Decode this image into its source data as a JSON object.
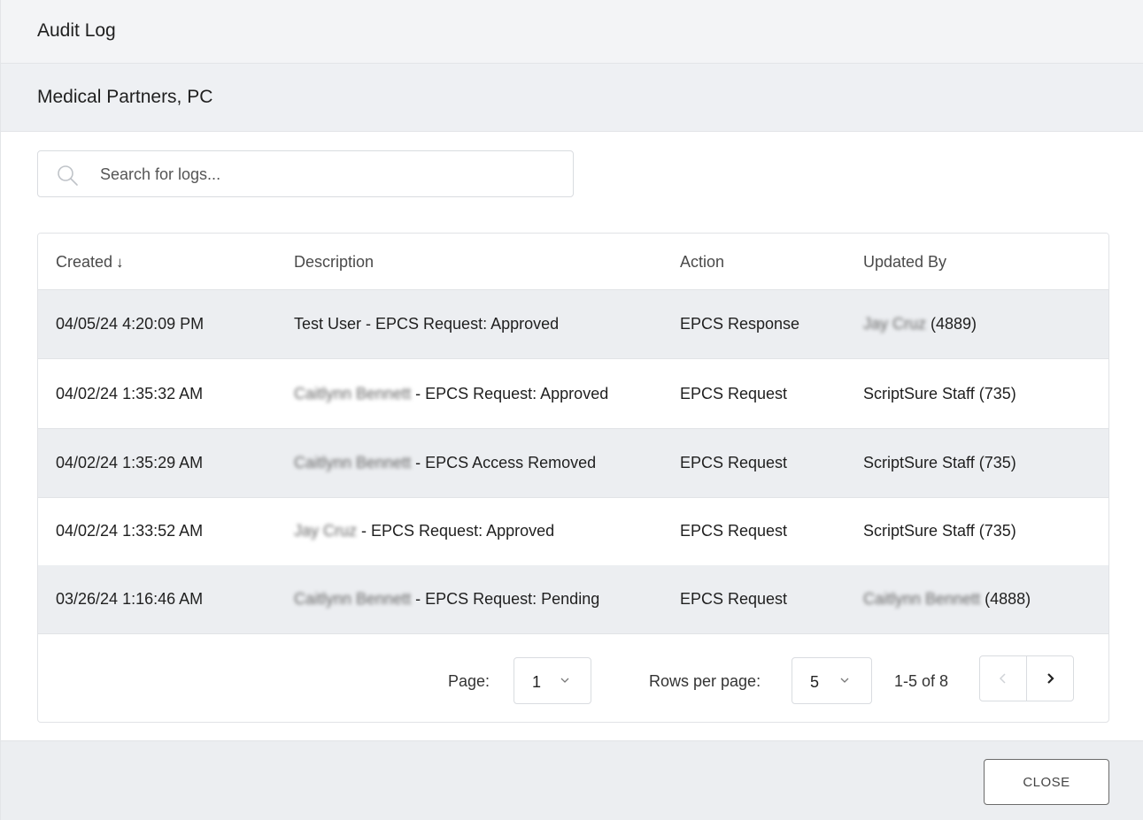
{
  "dialog": {
    "title": "Audit Log",
    "organization": "Medical Partners, PC"
  },
  "search": {
    "placeholder": "Search for logs..."
  },
  "table": {
    "columns": [
      "Created",
      "Description",
      "Action",
      "Updated By"
    ],
    "sort_indicator": "↓",
    "rows": [
      {
        "created": "04/05/24 4:20:09 PM",
        "desc_name": "",
        "desc_text": "Test User - EPCS Request: Approved",
        "action": "EPCS Response",
        "updated_name": "Jay Cruz",
        "updated_suffix": " (4889)"
      },
      {
        "created": "04/02/24 1:35:32 AM",
        "desc_name": "Caitlynn Bennett",
        "desc_text": " - EPCS Request: Approved",
        "action": "EPCS Request",
        "updated_name": "",
        "updated_suffix": "ScriptSure Staff (735)"
      },
      {
        "created": "04/02/24 1:35:29 AM",
        "desc_name": "Caitlynn Bennett",
        "desc_text": " - EPCS Access Removed",
        "action": "EPCS Request",
        "updated_name": "",
        "updated_suffix": "ScriptSure Staff (735)"
      },
      {
        "created": "04/02/24 1:33:52 AM",
        "desc_name": "Jay Cruz",
        "desc_text": " - EPCS Request: Approved",
        "action": "EPCS Request",
        "updated_name": "",
        "updated_suffix": "ScriptSure Staff (735)"
      },
      {
        "created": "03/26/24 1:16:46 AM",
        "desc_name": "Caitlynn Bennett",
        "desc_text": " - EPCS Request: Pending",
        "action": "EPCS Request",
        "updated_name": "Caitlynn Bennett",
        "updated_suffix": " (4888)"
      }
    ]
  },
  "pagination": {
    "page_label": "Page:",
    "page_value": "1",
    "rows_label": "Rows per page:",
    "rows_value": "5",
    "range": "1-5 of 8"
  },
  "footer": {
    "close_label": "CLOSE"
  }
}
